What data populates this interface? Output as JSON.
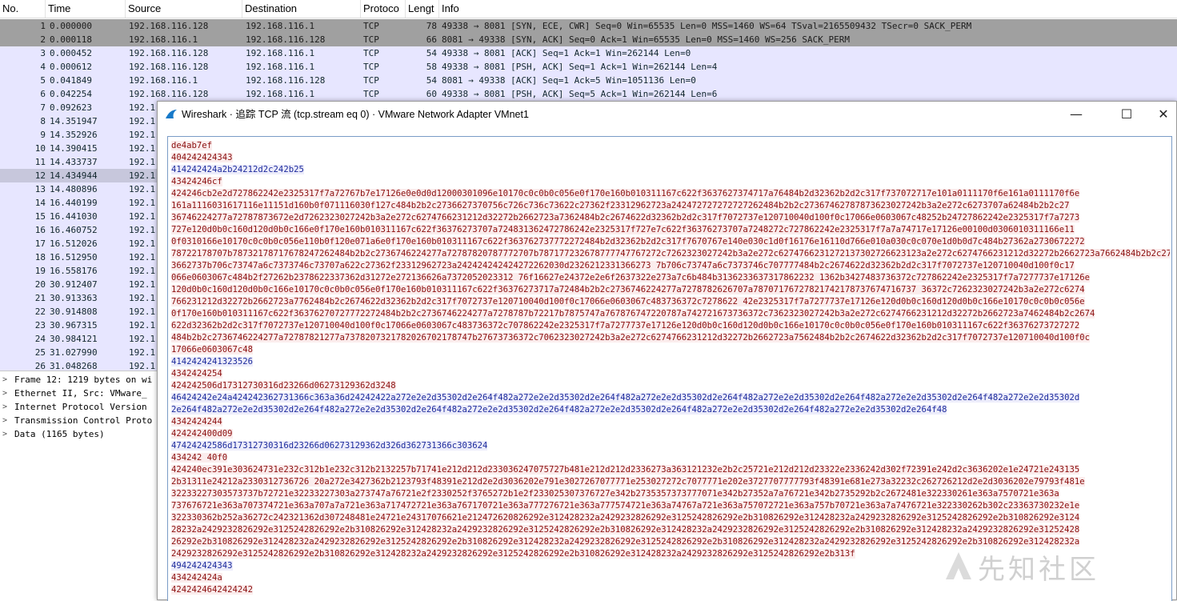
{
  "packet_list": {
    "headers": [
      "No.",
      "Time",
      "Source",
      "Destination",
      "Protoco",
      "Lengt",
      "Info"
    ],
    "rows": [
      {
        "no": "1",
        "time": "0.000000",
        "src": "192.168.116.128",
        "dst": "192.168.116.1",
        "proto": "TCP",
        "len": "78",
        "info": "49338 → 8081 [SYN, ECE, CWR] Seq=0 Win=65535 Len=0 MSS=1460 WS=64 TSval=2165509432 TSecr=0 SACK_PERM",
        "style": "syn"
      },
      {
        "no": "2",
        "time": "0.000118",
        "src": "192.168.116.1",
        "dst": "192.168.116.128",
        "proto": "TCP",
        "len": "66",
        "info": "8081 → 49338 [SYN, ACK] Seq=0 Ack=1 Win=65535 Len=0 MSS=1460 WS=256 SACK_PERM",
        "style": "syn"
      },
      {
        "no": "3",
        "time": "0.000452",
        "src": "192.168.116.128",
        "dst": "192.168.116.1",
        "proto": "TCP",
        "len": "54",
        "info": "49338 → 8081 [ACK] Seq=1 Ack=1 Win=262144 Len=0",
        "style": "tcp"
      },
      {
        "no": "4",
        "time": "0.000612",
        "src": "192.168.116.128",
        "dst": "192.168.116.1",
        "proto": "TCP",
        "len": "58",
        "info": "49338 → 8081 [PSH, ACK] Seq=1 Ack=1 Win=262144 Len=4",
        "style": "tcp"
      },
      {
        "no": "5",
        "time": "0.041849",
        "src": "192.168.116.1",
        "dst": "192.168.116.128",
        "proto": "TCP",
        "len": "54",
        "info": "8081 → 49338 [ACK] Seq=1 Ack=5 Win=1051136 Len=0",
        "style": "tcp"
      },
      {
        "no": "6",
        "time": "0.042254",
        "src": "192.168.116.128",
        "dst": "192.168.116.1",
        "proto": "TCP",
        "len": "60",
        "info": "49338 → 8081 [PSH, ACK] Seq=5 Ack=1 Win=262144 Len=6",
        "style": "tcp"
      },
      {
        "no": "7",
        "time": "0.092623",
        "src": "192.1",
        "style": "tcp"
      },
      {
        "no": "8",
        "time": "14.351947",
        "src": "192.1",
        "style": "tcp"
      },
      {
        "no": "9",
        "time": "14.352926",
        "src": "192.1",
        "style": "tcp"
      },
      {
        "no": "10",
        "time": "14.390415",
        "src": "192.1",
        "style": "tcp"
      },
      {
        "no": "11",
        "time": "14.433737",
        "src": "192.1",
        "style": "tcp"
      },
      {
        "no": "12",
        "time": "14.434944",
        "src": "192.1",
        "style": "sel"
      },
      {
        "no": "13",
        "time": "14.480896",
        "src": "192.1",
        "style": "tcp"
      },
      {
        "no": "14",
        "time": "16.440199",
        "src": "192.1",
        "style": "tcp"
      },
      {
        "no": "15",
        "time": "16.441030",
        "src": "192.1",
        "style": "tcp"
      },
      {
        "no": "16",
        "time": "16.460752",
        "src": "192.1",
        "style": "tcp"
      },
      {
        "no": "17",
        "time": "16.512026",
        "src": "192.1",
        "style": "tcp"
      },
      {
        "no": "18",
        "time": "16.512950",
        "src": "192.1",
        "style": "tcp"
      },
      {
        "no": "19",
        "time": "16.558176",
        "src": "192.1",
        "style": "tcp"
      },
      {
        "no": "20",
        "time": "30.912407",
        "src": "192.1",
        "style": "tcp"
      },
      {
        "no": "21",
        "time": "30.913363",
        "src": "192.1",
        "style": "tcp"
      },
      {
        "no": "22",
        "time": "30.914808",
        "src": "192.1",
        "style": "tcp"
      },
      {
        "no": "23",
        "time": "30.967315",
        "src": "192.1",
        "style": "tcp"
      },
      {
        "no": "24",
        "time": "30.984121",
        "src": "192.1",
        "style": "tcp"
      },
      {
        "no": "25",
        "time": "31.027990",
        "src": "192.1",
        "style": "tcp"
      },
      {
        "no": "26",
        "time": "31.048268",
        "src": "192.1",
        "style": "tcp"
      }
    ]
  },
  "packet_details": [
    {
      "arrow": ">",
      "text": "Frame 12: 1219 bytes on wi"
    },
    {
      "arrow": ">",
      "text": "Ethernet II, Src: VMware_"
    },
    {
      "arrow": ">",
      "text": "Internet Protocol Version"
    },
    {
      "arrow": ">",
      "text": "Transmission Control Proto"
    },
    {
      "arrow": ">",
      "text": "Data (1165 bytes)"
    }
  ],
  "dialog": {
    "title": "Wireshark · 追踪 TCP 流 (tcp.stream eq 0) · VMware Network Adapter VMnet1",
    "icon": "wireshark-fin-icon",
    "minimize": "—",
    "maximize": "☐",
    "close": "✕"
  },
  "stream_lines": [
    {
      "dir": "c",
      "text": "de4ab7ef"
    },
    {
      "dir": "c",
      "text": "404242424343"
    },
    {
      "dir": "s",
      "text": "414242424a2b24212d2c242b25"
    },
    {
      "dir": "c",
      "text": "43424246cf"
    },
    {
      "dir": "c",
      "text": "424246cb2e2d727862242e2325317f7a72767b7e17126e0e0d0d12000301096e10170c0c0b0c056e0f170e160b010311167c622f3637627374717a76484b2d32362b2d2c317f737072717e101a0111170f6e161a0111170f6e"
    },
    {
      "dir": "c",
      "text": "161a1116031617116e11151d160b0f071116030f127c484b2b2c2736627370756c726c736c73622c27362f23312962723a242472727272727262484b2b2c27367462787873623027242b3a2e272c6273707a62484b2b2c27"
    },
    {
      "dir": "c",
      "text": "36746224277a72787873672e2d7262323027242b3a2e272c6274766231212d32272b2662723a7362484b2c2674622d32362b2d2c317f7072737e120710040d100f0c17066e0603067c48252b24727862242e2325317f7a7273"
    },
    {
      "dir": "c",
      "text": "727e120d0b0c160d120d0b0c166e0f170e160b010311167c622f36376273707a724831362472786242e2325317f727e7c622f36376273707a7248272c727862242e2325317f7a7a74717e17126e00100d0306010311166e11"
    },
    {
      "dir": "c",
      "text": "0f0310166e10170c0c0b0c056e110b0f120e071a6e0f170e160b010311167c622f363762737772272484b2d32362b2d2c317f7670767e140e030c1d0f16176e16110d766e010a030c0c070e1d0b0d7c484b27362a2730672272"
    },
    {
      "dir": "c",
      "text": "78722178707b78732178717678247262484b2b2c2736746224277a72787820787772707b787177232678777747767272c7262323027242b3a2e272c6274766231272137302726623123a2e272c6274766231212d32272b2662723a7662484b2b2c27"
    },
    {
      "dir": "c",
      "text": "3662737b706c73747a6c7373746c73707a622c27362f23312962723a242424242424272262030d2326212331366273 7b706c73747a6c7373746c707777484b2c2674622d32362b2d2c317f7072737e120710040d100f0c17"
    },
    {
      "dir": "c",
      "text": "066e0603067c484b2f27262b2378622337362d31272e272136626a7372052023312 76f16627e24372e2e6f2637322e273a7c6b484b3136233637317862232 1362b3427483736372c727862242e2325317f7a7277737e17126e"
    },
    {
      "dir": "c",
      "text": "120d0b0c160d120d0b0c166e10170c0c0b0c056e0f170e160b010311167c622f36376273717a72484b2b2c2736746224277a7278782626707a78707176727821742178737674716737 36372c7262323027242b3a2e272c6274"
    },
    {
      "dir": "c",
      "text": "766231212d32272b2662723a7762484b2c2674622d32362b2d2c317f7072737e120710040d100f0c17066e0603067c483736372c7278622 42e2325317f7a7277737e17126e120d0b0c160d120d0b0c166e10170c0c0b0c056e"
    },
    {
      "dir": "c",
      "text": "0f170e160b010311167c622f36376270727772272484b2b2c2736746224277a7278787b72217b7875747a767876747220787a742721673736372c7362323027242b3a2e272c6274766231212d32272b2662723a7462484b2c2674"
    },
    {
      "dir": "c",
      "text": "622d32362b2d2c317f7072737e120710040d100f0c17066e0603067c483736372c707862242e2325317f7a7277737e17126e120d0b0c160d120d0b0c166e10170c0c0b0c056e0f170e160b010311167c622f36376273727272"
    },
    {
      "dir": "c",
      "text": "484b2b2c2736746224277a72787821277a7378207321782026702178747b27673736372c7062323027242b3a2e272c6274766231212d32272b2662723a7562484b2b2c2674622d32362b2d2c317f7072737e120710040d100f0c"
    },
    {
      "dir": "c",
      "text": "17066e0603067c48"
    },
    {
      "dir": "s",
      "text": "4142424241323526"
    },
    {
      "dir": "c",
      "text": "4342424254"
    },
    {
      "dir": "c",
      "text": "424242506d17312730316d23266d06273129362d3248"
    },
    {
      "dir": "s",
      "text": "46424242e24a424242362731366c363a36d24242422a272e2e2d35302d2e264f482a272e2e2d35302d2e264f482a272e2e2d35302d2e264f482a272e2e2d35302d2e264f482a272e2e2d35302d2e264f482a272e2e2d35302d"
    },
    {
      "dir": "s",
      "text": "2e264f482a272e2e2d35302d2e264f482a272e2e2d35302d2e264f482a272e2e2d35302d2e264f482a272e2e2d35302d2e264f482a272e2e2d35302d2e264f482a272e2e2d35302d2e264f48"
    },
    {
      "dir": "c",
      "text": "4342424244"
    },
    {
      "dir": "c",
      "text": "424242400d09"
    },
    {
      "dir": "s",
      "text": "47424242586d17312730316d23266d06273129362d326d362731366c303624"
    },
    {
      "dir": "c",
      "text": "434242 40f0"
    },
    {
      "dir": "c",
      "text": "424240ec391e303624731e232c312b1e232c312b2132257b71741e212d212d233036247075727b481e212d212d2336273a363121232e2b2c25721e212d212d23322e2336242d302f72391e242d2c3636202e1e24721e243135"
    },
    {
      "dir": "c",
      "text": "2b31311e24212a2330312736726 20a272e3427362b2123793f48391e212d2e2d3036202e791e3027267077771e253027272c7077771e202e3727707777793f48391e681e273a32232c262726212d2e2d3036202e79793f481e"
    },
    {
      "dir": "c",
      "text": "32233227303573737b72721e32233227303a273747a76721e2f2330252f3765272b1e2f233025307376727e342b2735357373777071e342b27352a7a76721e342b2735292b2c2672481e322330261e363a7570721e363a"
    },
    {
      "dir": "c",
      "text": "737676721e363a707374721e363a707a7a721e363a717472721e363a767170721e363a777276721e363a777574721e363a74767a721e363a757072721e363a757b70721e363a7a7476721e322330262b302c23363730232e1e"
    },
    {
      "dir": "c",
      "text": "322330362b252a36272c242321362d307248481e24721e24317076621e212472620826292e312428232a2429232826292e3125242826292e2b310826292e312428232a2429232826292e3125242826292e2b310826292e3124"
    },
    {
      "dir": "c",
      "text": "28232a2429232826292e3125242826292e2b310826292e312428232a2429232826292e3125242826292e2b310826292e312428232a2429232826292e3125242826292e2b310826292e312428232a2429232826292e31252428"
    },
    {
      "dir": "c",
      "text": "26292e2b310826292e312428232a2429232826292e3125242826292e2b310826292e312428232a2429232826292e3125242826292e2b310826292e312428232a2429232826292e3125242826292e2b310826292e312428232a"
    },
    {
      "dir": "c",
      "text": "2429232826292e3125242826292e2b310826292e312428232a2429232826292e3125242826292e2b310826292e312428232a2429232826292e3125242826292e2b313f"
    },
    {
      "dir": "s",
      "text": "494242424343"
    },
    {
      "dir": "c",
      "text": "434242424a"
    },
    {
      "dir": "c",
      "text": "4242424642424242"
    }
  ],
  "watermark": "先知社区",
  "colors": {
    "client_text": "#8b0e0e",
    "server_text": "#1c2a9c",
    "syn_row": "#a0a0a0",
    "tcp_row": "#e7e6ff",
    "selected_row": "#c7c7dc"
  }
}
